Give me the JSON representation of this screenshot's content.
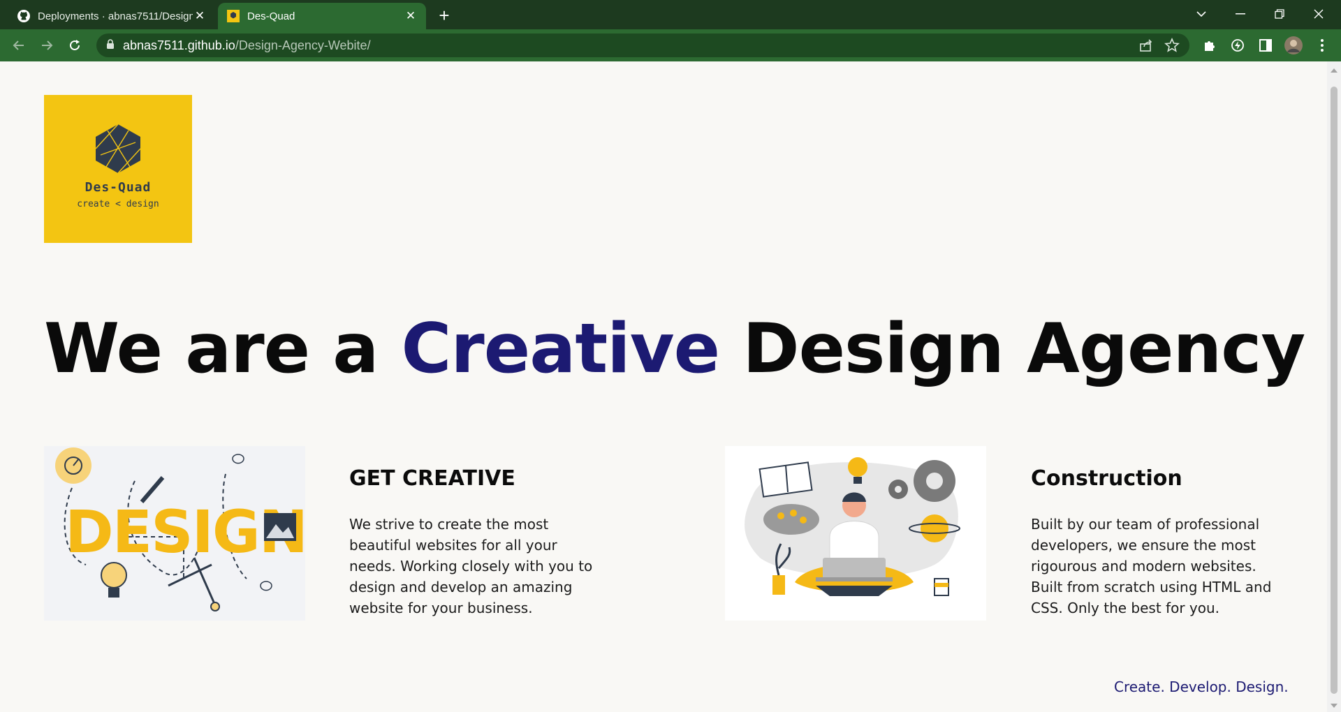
{
  "browser": {
    "tabs": [
      {
        "title": "Deployments · abnas7511/Design",
        "icon": "github-icon",
        "active": false
      },
      {
        "title": "Des-Quad",
        "icon": "site-favicon",
        "active": true
      }
    ],
    "url_host": "abnas7511.github.io",
    "url_path": "/Design-Agency-Webite/",
    "theme_color": "#2c6a31"
  },
  "logo": {
    "name": "Des-Quad",
    "tagline": "create < design",
    "background": "#f3c512"
  },
  "hero": {
    "part1": "We are a ",
    "accent": "Creative",
    "part2": " Design Agency",
    "accent_color": "#1c1a72"
  },
  "sections": [
    {
      "title": "GET CREATIVE",
      "text": "We strive to create the most beautiful websites for all your needs. Working closely with you to design and develop an amazing website for your business.",
      "illustration_word": "DESIGN"
    },
    {
      "title": "Construction",
      "text": "Built by our team of professional developers, we ensure the most rigourous and modern websites. Built from scratch using HTML and CSS. Only the best for you."
    }
  ],
  "footer": {
    "tagline": "Create. Develop. Design."
  }
}
